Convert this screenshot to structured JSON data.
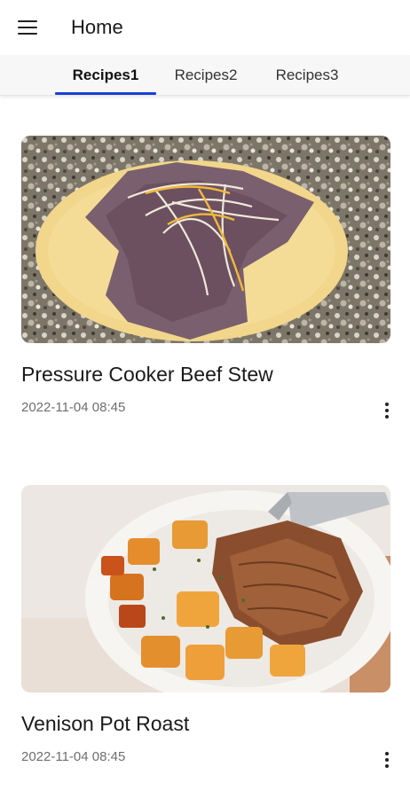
{
  "app_bar": {
    "title": "Home",
    "menu_icon": "hamburger-menu-icon"
  },
  "tabs": [
    {
      "label": "Recipes1",
      "selected": true
    },
    {
      "label": "Recipes2",
      "selected": false
    },
    {
      "label": "Recipes3",
      "selected": false
    }
  ],
  "colors": {
    "tab_indicator": "#1a3fd6",
    "tabbar_background": "#f7f7f7"
  },
  "recipes": [
    {
      "title": "Pressure Cooker Beef Stew",
      "date": "2022-11-04 08:45",
      "image": "shredded-beef-on-corn-tortilla-photo",
      "more_icon": "more-vertical-icon"
    },
    {
      "title": "Venison Pot Roast",
      "date": "2022-11-04 08:45",
      "image": "pot-roast-with-squash-in-bowl-photo",
      "more_icon": "more-vertical-icon"
    }
  ]
}
